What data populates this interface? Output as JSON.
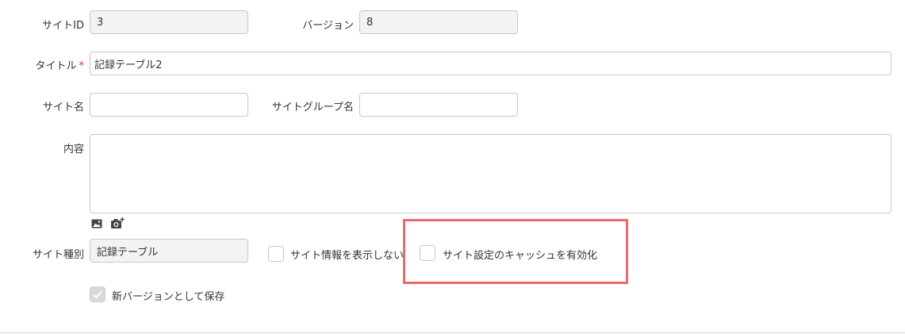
{
  "form": {
    "site_id": {
      "label": "サイトID",
      "value": "3"
    },
    "version": {
      "label": "バージョン",
      "value": "8"
    },
    "title": {
      "label": "タイトル",
      "required_mark": "*",
      "value": "記録テーブル2"
    },
    "site_name": {
      "label": "サイト名",
      "value": ""
    },
    "site_group_name": {
      "label": "サイトグループ名",
      "value": ""
    },
    "body": {
      "label": "内容",
      "value": ""
    },
    "site_type": {
      "label": "サイト種別",
      "value": "記録テーブル"
    },
    "hide_site_info": {
      "label": "サイト情報を表示しない",
      "checked": false
    },
    "enable_cache": {
      "label": "サイト設定のキャッシュを有効化",
      "checked": false
    },
    "save_as_new_version": {
      "label": "新バージョンとして保存",
      "checked": true
    }
  },
  "icons": {
    "insert_image": "image-icon",
    "camera": "camera-icon",
    "check": "checkmark-icon"
  },
  "colors": {
    "highlight": "#e86a6a",
    "required": "#e0301e"
  }
}
